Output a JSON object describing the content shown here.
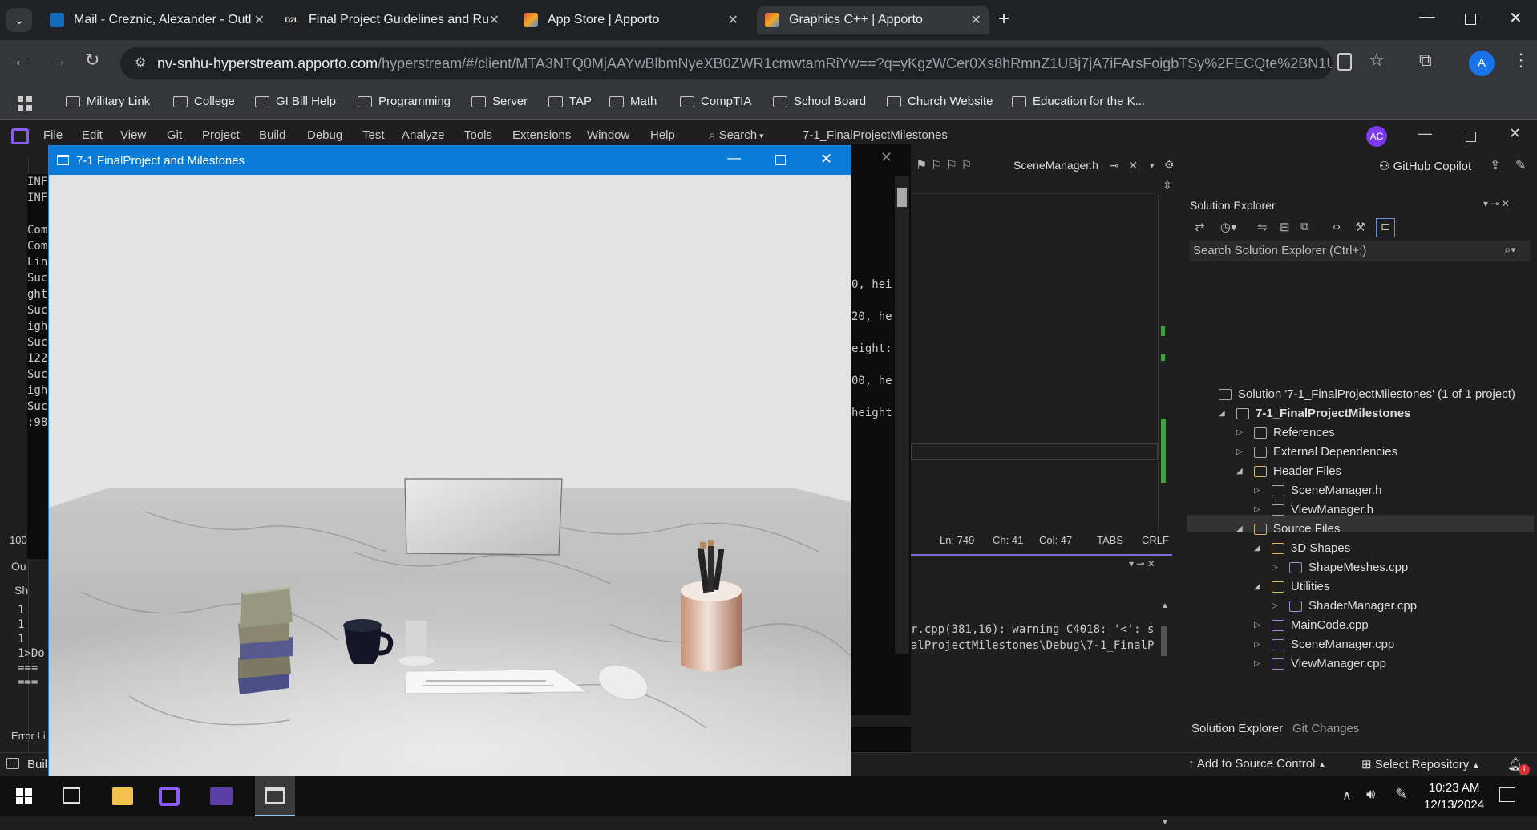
{
  "browser": {
    "tabs": [
      {
        "title": "Mail - Creznic, Alexander - Outl",
        "icon": "outlook-icon",
        "color": "#0f6cbd"
      },
      {
        "title": "Final Project Guidelines and Ru",
        "icon": "d2l-icon",
        "color": "#222222"
      },
      {
        "title": "App Store | Apporto",
        "icon": "apporto-icon",
        "color": "#e0533a"
      },
      {
        "title": "Graphics C++ | Apporto",
        "icon": "apporto-icon",
        "color": "#e0533a"
      }
    ],
    "url_host": "nv-snhu-hyperstream.apporto.com",
    "url_path": "/hyperstream/#/client/MTA3NTQ0MjAAYwBlbmNyeXB0ZWR1cmwtamRiYw==?q=yKgzWCer0Xs8hRmnZ1UBj7jA7iFArsFoigbTSy%2FECQte%2BN1UFXiEL...",
    "profile_initial": "A",
    "bookmarks": [
      "Military Link",
      "College",
      "GI Bill Help",
      "Programming",
      "Server",
      "TAP",
      "Math",
      "CompTIA",
      "School Board",
      "Church Website",
      "Education for the K..."
    ]
  },
  "vs": {
    "menu": [
      "File",
      "Edit",
      "View",
      "Git",
      "Project",
      "Build",
      "Debug",
      "Test",
      "Analyze",
      "Tools",
      "Extensions",
      "Window",
      "Help"
    ],
    "search_label": "Search",
    "solution_title": "7-1_FinalProjectMilestones",
    "user_initials": "AC",
    "copilot": "GitHub Copilot",
    "doc_tab": "SceneManager.h",
    "status_ln": "Ln: 749",
    "status_ch": "Ch: 41",
    "status_col": "Col: 47",
    "status_tabs": "TABS",
    "status_crlf": "CRLF",
    "zoom": "100",
    "output_tab": "Ou",
    "output_show": "Sh",
    "error_list": "Error Li",
    "build_status": "Buil",
    "console_left": [
      "INF",
      "INF",
      "",
      "Com",
      "Com",
      "Lin",
      "Suc",
      "ght",
      "Suc",
      "igh",
      "Suc",
      "122",
      "Suc",
      "igh",
      "Suc",
      ":98"
    ],
    "console_right": [
      "0, hei",
      "20, he",
      "eight:",
      "00, he",
      "height"
    ],
    "output_left": [
      "1",
      "1",
      "1",
      "1>Do",
      "===",
      "==="
    ],
    "output_lines": [
      "r.cpp(381,16): warning C4018: '<': s",
      "alProjectMilestones\\Debug\\7-1_FinalP"
    ],
    "add_source": "Add to Source Control",
    "select_repo": "Select Repository",
    "notif_count": "1",
    "se_title": "Solution Explorer",
    "se_search": "Search Solution Explorer (Ctrl+;)",
    "se_bottom_tabs": [
      "Solution Explorer",
      "Git Changes"
    ],
    "tree": [
      {
        "label": "Solution '7-1_FinalProjectMilestones' (1 of 1 project)",
        "tri": "",
        "icon": "solution-icon"
      },
      {
        "label": "7-1_FinalProjectMilestones",
        "tri": "◢",
        "icon": "project-icon",
        "bold": true
      },
      {
        "label": "References",
        "tri": "▷",
        "icon": "references-icon"
      },
      {
        "label": "External Dependencies",
        "tri": "▷",
        "icon": "dependencies-icon"
      },
      {
        "label": "Header Files",
        "tri": "◢",
        "icon": "folder-icon"
      },
      {
        "label": "SceneManager.h",
        "tri": "▷",
        "icon": "header-file-icon"
      },
      {
        "label": "ViewManager.h",
        "tri": "▷",
        "icon": "header-file-icon"
      },
      {
        "label": "Source Files",
        "tri": "◢",
        "icon": "folder-icon"
      },
      {
        "label": "3D Shapes",
        "tri": "◢",
        "icon": "folder-icon"
      },
      {
        "label": "ShapeMeshes.cpp",
        "tri": "▷",
        "icon": "cpp-file-icon"
      },
      {
        "label": "Utilities",
        "tri": "◢",
        "icon": "folder-icon"
      },
      {
        "label": "ShaderManager.cpp",
        "tri": "▷",
        "icon": "cpp-file-icon"
      },
      {
        "label": "MainCode.cpp",
        "tri": "▷",
        "icon": "cpp-file-icon"
      },
      {
        "label": "SceneManager.cpp",
        "tri": "▷",
        "icon": "cpp-file-icon",
        "selected": true
      },
      {
        "label": "ViewManager.cpp",
        "tri": "▷",
        "icon": "cpp-file-icon"
      }
    ]
  },
  "glwindow": {
    "title": "7-1 FinalProject and Milestones"
  },
  "taskbar": {
    "time": "10:23 AM",
    "date": "12/13/2024"
  }
}
